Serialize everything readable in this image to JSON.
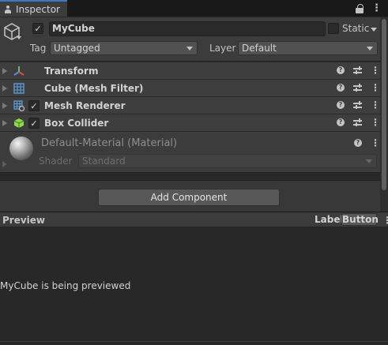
{
  "window": {
    "tab_title": "Inspector",
    "tab_icon": "info-icon",
    "lock_icon": "lock-icon",
    "menu_icon": "kebab-menu-icon",
    "accent_color": "#3a79bb"
  },
  "header": {
    "object_icon": "cube-icon",
    "active_checked": true,
    "name_value": "MyCube",
    "static_checked": false,
    "static_label": "Static",
    "tag_label": "Tag",
    "tag_value": "Untagged",
    "layer_label": "Layer",
    "layer_value": "Default"
  },
  "components": [
    {
      "title": "Transform",
      "icon": "transform-axes-icon",
      "has_checkbox": false
    },
    {
      "title": "Cube (Mesh Filter)",
      "icon": "mesh-filter-grid-icon",
      "has_checkbox": false
    },
    {
      "title": "Mesh Renderer",
      "icon": "mesh-renderer-icon",
      "has_checkbox": true,
      "checked": true
    },
    {
      "title": "Box Collider",
      "icon": "box-collider-icon",
      "has_checkbox": true,
      "checked": true
    }
  ],
  "material": {
    "title": "Default-Material (Material)",
    "shader_label": "Shader",
    "shader_value": "Standard",
    "icon": "material-sphere-icon"
  },
  "add_component": {
    "label": "Add Component"
  },
  "preview": {
    "title": "Preview",
    "label_text": "Label",
    "button_label": "Button",
    "body_text": "MyCube is being previewed"
  }
}
